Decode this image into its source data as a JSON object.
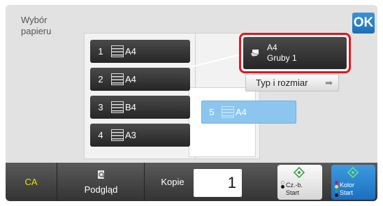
{
  "header": {
    "paper_label": "Wybór\npapieru",
    "ok_label": "OK"
  },
  "trays": [
    {
      "number": "1",
      "size": "A4"
    },
    {
      "number": "2",
      "size": "A4"
    },
    {
      "number": "3",
      "size": "B4"
    },
    {
      "number": "4",
      "size": "A3"
    }
  ],
  "bypass_tray": {
    "number": "5",
    "size": "A4"
  },
  "selected_paper": {
    "size": "A4",
    "type": "Gruby 1"
  },
  "type_size_button": {
    "label": "Typ i rozmiar"
  },
  "bottom_bar": {
    "ca_label": "CA",
    "preview_label": "Podgląd",
    "copies_label": "Kopie",
    "copies_value": "1",
    "bw_start_line1": "Cz.-b.",
    "bw_start_line2": "Start",
    "color_start_line1": "Kolor",
    "color_start_line2": "Start"
  },
  "colors": {
    "accent_blue": "#1d6fb5",
    "highlight_red": "#e0171f",
    "bypass_blue": "#8cc6ee",
    "ca_yellow": "#e8e000"
  },
  "icons": [
    "paper-stack-icon",
    "hand-paper-icon",
    "right-arrow-icon",
    "magnifier-icon",
    "diamond-start-icon"
  ]
}
